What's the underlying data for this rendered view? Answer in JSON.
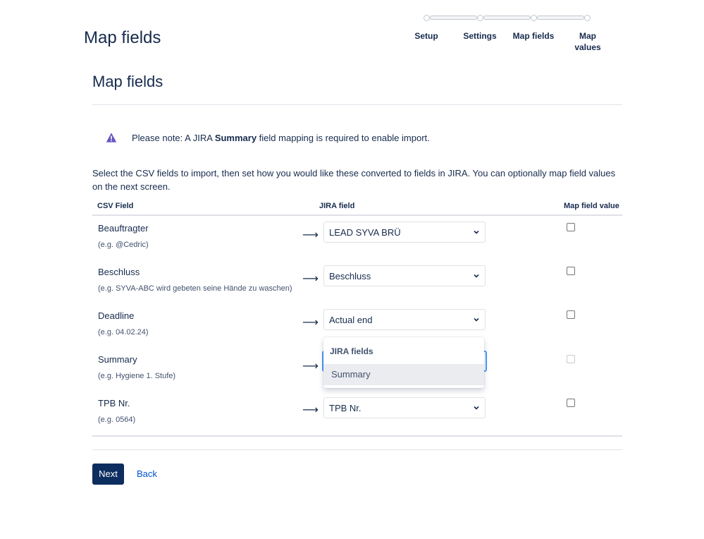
{
  "page": {
    "title": "Map fields"
  },
  "progress": {
    "steps": [
      "Setup",
      "Settings",
      "Map fields",
      "Map values"
    ]
  },
  "section": {
    "title": "Map fields"
  },
  "notice": {
    "prefix": "Please note: A JIRA ",
    "bold": "Summary",
    "suffix": " field mapping is required to enable import.",
    "icon": "warning-icon",
    "icon_color": "#6554c0"
  },
  "intro": "Select the CSV fields to import, then set how you would like these converted to fields in JIRA. You can optionally map field values on the next screen.",
  "table": {
    "headers": {
      "csv": "CSV Field",
      "jira": "JIRA field",
      "map": "Map field value"
    },
    "rows": [
      {
        "csv": "Beauftragter",
        "example": "(e.g. @Cedric)",
        "jira": "LEAD SYVA BRÜ",
        "checked": false,
        "disabled": false
      },
      {
        "csv": "Beschluss",
        "example": "(e.g. SYVA-ABC wird gebeten seine Hände zu waschen)",
        "jira": "Beschluss",
        "checked": false,
        "disabled": false
      },
      {
        "csv": "Deadline",
        "example": "(e.g. 04.02.24)",
        "jira": "Actual end",
        "checked": false,
        "disabled": false
      },
      {
        "csv": "Summary",
        "example": "(e.g. Hygiene 1. Stufe)",
        "jira": "",
        "checked": false,
        "disabled": true
      },
      {
        "csv": "TPB Nr.",
        "example": "(e.g. 0564)",
        "jira": "TPB Nr.",
        "checked": false,
        "disabled": false
      }
    ]
  },
  "dropdown": {
    "group": "JIRA fields",
    "option": "Summary"
  },
  "actions": {
    "next": "Next",
    "back": "Back"
  },
  "colors": {
    "primary": "#0c2d5e",
    "link": "#0052cc",
    "focus": "#4c9aff"
  }
}
